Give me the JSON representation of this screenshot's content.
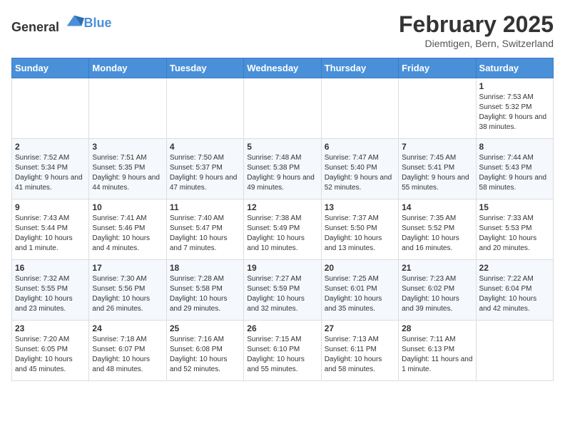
{
  "header": {
    "logo_general": "General",
    "logo_blue": "Blue",
    "title": "February 2025",
    "subtitle": "Diemtigen, Bern, Switzerland"
  },
  "calendar": {
    "weekdays": [
      "Sunday",
      "Monday",
      "Tuesday",
      "Wednesday",
      "Thursday",
      "Friday",
      "Saturday"
    ],
    "weeks": [
      [
        {
          "day": "",
          "info": ""
        },
        {
          "day": "",
          "info": ""
        },
        {
          "day": "",
          "info": ""
        },
        {
          "day": "",
          "info": ""
        },
        {
          "day": "",
          "info": ""
        },
        {
          "day": "",
          "info": ""
        },
        {
          "day": "1",
          "info": "Sunrise: 7:53 AM\nSunset: 5:32 PM\nDaylight: 9 hours and 38 minutes."
        }
      ],
      [
        {
          "day": "2",
          "info": "Sunrise: 7:52 AM\nSunset: 5:34 PM\nDaylight: 9 hours and 41 minutes."
        },
        {
          "day": "3",
          "info": "Sunrise: 7:51 AM\nSunset: 5:35 PM\nDaylight: 9 hours and 44 minutes."
        },
        {
          "day": "4",
          "info": "Sunrise: 7:50 AM\nSunset: 5:37 PM\nDaylight: 9 hours and 47 minutes."
        },
        {
          "day": "5",
          "info": "Sunrise: 7:48 AM\nSunset: 5:38 PM\nDaylight: 9 hours and 49 minutes."
        },
        {
          "day": "6",
          "info": "Sunrise: 7:47 AM\nSunset: 5:40 PM\nDaylight: 9 hours and 52 minutes."
        },
        {
          "day": "7",
          "info": "Sunrise: 7:45 AM\nSunset: 5:41 PM\nDaylight: 9 hours and 55 minutes."
        },
        {
          "day": "8",
          "info": "Sunrise: 7:44 AM\nSunset: 5:43 PM\nDaylight: 9 hours and 58 minutes."
        }
      ],
      [
        {
          "day": "9",
          "info": "Sunrise: 7:43 AM\nSunset: 5:44 PM\nDaylight: 10 hours and 1 minute."
        },
        {
          "day": "10",
          "info": "Sunrise: 7:41 AM\nSunset: 5:46 PM\nDaylight: 10 hours and 4 minutes."
        },
        {
          "day": "11",
          "info": "Sunrise: 7:40 AM\nSunset: 5:47 PM\nDaylight: 10 hours and 7 minutes."
        },
        {
          "day": "12",
          "info": "Sunrise: 7:38 AM\nSunset: 5:49 PM\nDaylight: 10 hours and 10 minutes."
        },
        {
          "day": "13",
          "info": "Sunrise: 7:37 AM\nSunset: 5:50 PM\nDaylight: 10 hours and 13 minutes."
        },
        {
          "day": "14",
          "info": "Sunrise: 7:35 AM\nSunset: 5:52 PM\nDaylight: 10 hours and 16 minutes."
        },
        {
          "day": "15",
          "info": "Sunrise: 7:33 AM\nSunset: 5:53 PM\nDaylight: 10 hours and 20 minutes."
        }
      ],
      [
        {
          "day": "16",
          "info": "Sunrise: 7:32 AM\nSunset: 5:55 PM\nDaylight: 10 hours and 23 minutes."
        },
        {
          "day": "17",
          "info": "Sunrise: 7:30 AM\nSunset: 5:56 PM\nDaylight: 10 hours and 26 minutes."
        },
        {
          "day": "18",
          "info": "Sunrise: 7:28 AM\nSunset: 5:58 PM\nDaylight: 10 hours and 29 minutes."
        },
        {
          "day": "19",
          "info": "Sunrise: 7:27 AM\nSunset: 5:59 PM\nDaylight: 10 hours and 32 minutes."
        },
        {
          "day": "20",
          "info": "Sunrise: 7:25 AM\nSunset: 6:01 PM\nDaylight: 10 hours and 35 minutes."
        },
        {
          "day": "21",
          "info": "Sunrise: 7:23 AM\nSunset: 6:02 PM\nDaylight: 10 hours and 39 minutes."
        },
        {
          "day": "22",
          "info": "Sunrise: 7:22 AM\nSunset: 6:04 PM\nDaylight: 10 hours and 42 minutes."
        }
      ],
      [
        {
          "day": "23",
          "info": "Sunrise: 7:20 AM\nSunset: 6:05 PM\nDaylight: 10 hours and 45 minutes."
        },
        {
          "day": "24",
          "info": "Sunrise: 7:18 AM\nSunset: 6:07 PM\nDaylight: 10 hours and 48 minutes."
        },
        {
          "day": "25",
          "info": "Sunrise: 7:16 AM\nSunset: 6:08 PM\nDaylight: 10 hours and 52 minutes."
        },
        {
          "day": "26",
          "info": "Sunrise: 7:15 AM\nSunset: 6:10 PM\nDaylight: 10 hours and 55 minutes."
        },
        {
          "day": "27",
          "info": "Sunrise: 7:13 AM\nSunset: 6:11 PM\nDaylight: 10 hours and 58 minutes."
        },
        {
          "day": "28",
          "info": "Sunrise: 7:11 AM\nSunset: 6:13 PM\nDaylight: 11 hours and 1 minute."
        },
        {
          "day": "",
          "info": ""
        }
      ]
    ]
  }
}
